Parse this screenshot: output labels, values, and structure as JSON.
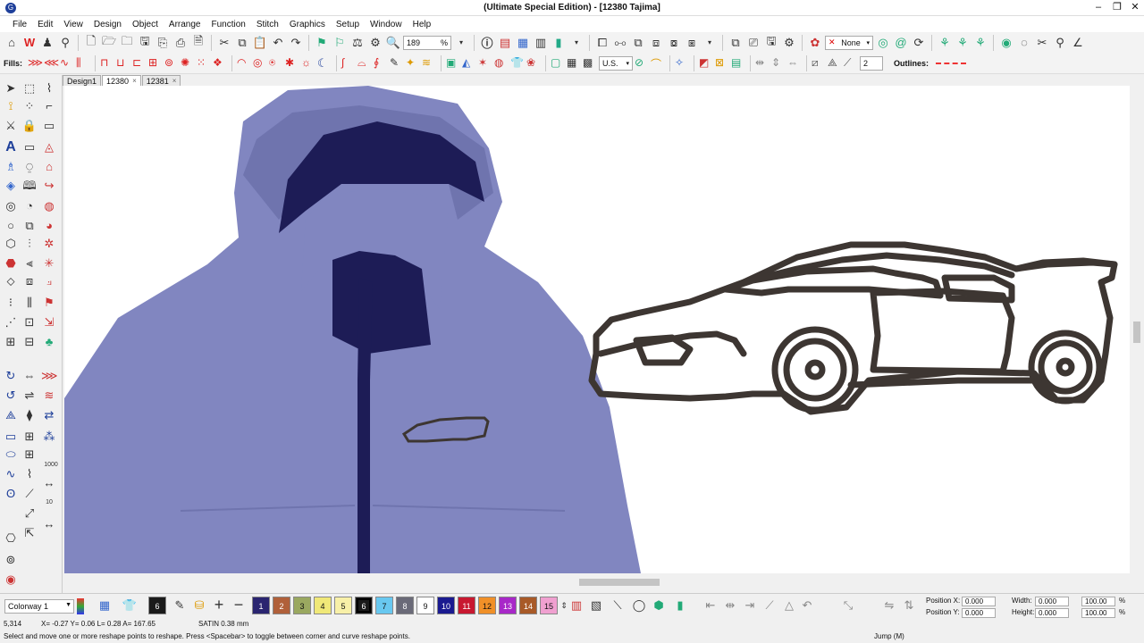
{
  "title": "(Ultimate Special Edition) - [12380       Tajima]",
  "window_buttons": [
    "–",
    "❐",
    "✕"
  ],
  "menu": [
    "File",
    "Edit",
    "View",
    "Design",
    "Object",
    "Arrange",
    "Function",
    "Stitch",
    "Graphics",
    "Setup",
    "Window",
    "Help"
  ],
  "toolbar1": {
    "zoom_value": "189",
    "zoom_unit": "%",
    "none_combo": "None"
  },
  "toolbar2": {
    "fills_label": "Fills:",
    "units_combo": "U.S.",
    "spin_value": "2",
    "outlines_label": "Outlines:"
  },
  "tabs": [
    "Design1",
    "12380",
    "12381"
  ],
  "tab_close": "×",
  "toolbox_labels": [
    "1000",
    "10"
  ],
  "colorway": "Colorway 1",
  "current_thread_number": "6",
  "threads": [
    {
      "num": "1",
      "color": "#2a2570"
    },
    {
      "num": "2",
      "color": "#b0603a"
    },
    {
      "num": "3",
      "color": "#9aa860"
    },
    {
      "num": "4",
      "color": "#f0e878"
    },
    {
      "num": "5",
      "color": "#f8f0a8"
    },
    {
      "num": "6",
      "color": "#1a1a1a"
    },
    {
      "num": "7",
      "color": "#68c8f0"
    },
    {
      "num": "8",
      "color": "#6a6a78"
    },
    {
      "num": "9",
      "color": "#ffffff"
    },
    {
      "num": "10",
      "color": "#1a1a90"
    },
    {
      "num": "11",
      "color": "#c81830"
    },
    {
      "num": "12",
      "color": "#f09028"
    },
    {
      "num": "13",
      "color": "#a828c8"
    },
    {
      "num": "14",
      "color": "#a85a28"
    },
    {
      "num": "15",
      "color": "#f0a0d0"
    }
  ],
  "position": {
    "x_label": "Position X:",
    "y_label": "Position Y:",
    "x": "0.000",
    "y": "0.000"
  },
  "size": {
    "w_label": "Width:",
    "h_label": "Height:",
    "w": "0.000",
    "h": "0.000",
    "wp": "100.00",
    "hp": "100.00",
    "pct": "%"
  },
  "status": {
    "stitches": "5,314",
    "coords": "X=  -0.27 Y=  0.06 L=  0.28 A= 167.65",
    "stitch_type": "SATIN  0.38 mm",
    "hint": "Select and move one or more reshape points to reshape. Press <Spacebar> to toggle between corner and curve reshape points.",
    "mode": "Jump (M)"
  },
  "colors": {
    "jacket": "#8186c0",
    "jacket_shadow": "#6f74ae",
    "zipper": "#1d1c56",
    "stitch": "#3d3632"
  }
}
